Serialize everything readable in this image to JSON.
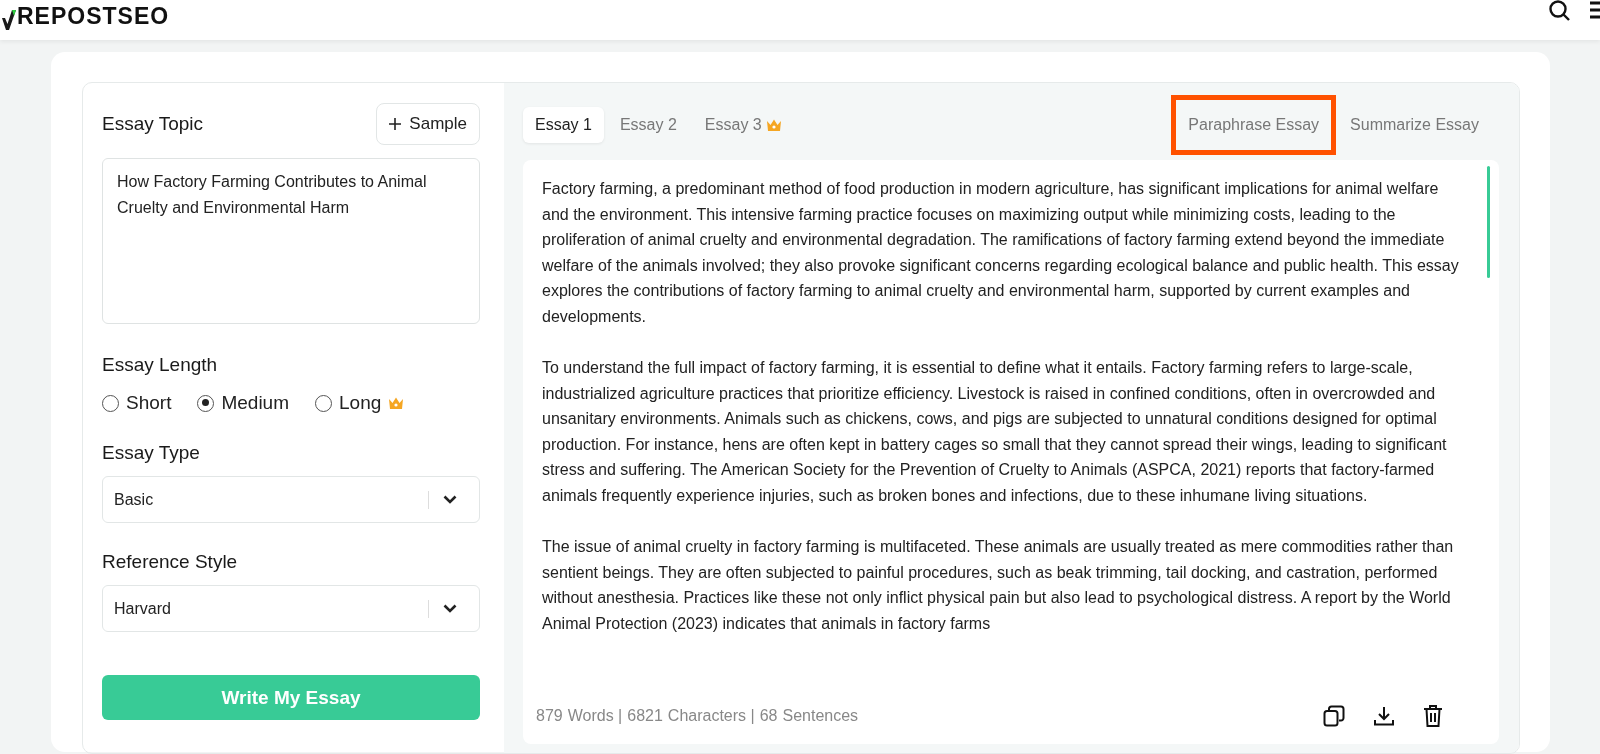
{
  "header": {
    "logo": "REPOSTSEO"
  },
  "form": {
    "topic_label": "Essay Topic",
    "sample_button": "Sample",
    "topic_value": "How Factory Farming Contributes to Animal Cruelty and Environmental Harm",
    "length_label": "Essay Length",
    "lengths": [
      {
        "label": "Short",
        "selected": false,
        "premium": false
      },
      {
        "label": "Medium",
        "selected": true,
        "premium": false
      },
      {
        "label": "Long",
        "selected": false,
        "premium": true
      }
    ],
    "type_label": "Essay Type",
    "type_value": "Basic",
    "reference_label": "Reference Style",
    "reference_value": "Harvard",
    "submit": "Write My Essay"
  },
  "tabs": [
    {
      "label": "Essay 1",
      "selected": true,
      "premium": false
    },
    {
      "label": "Essay 2",
      "selected": false,
      "premium": false
    },
    {
      "label": "Essay 3",
      "selected": false,
      "premium": true
    }
  ],
  "actions": [
    {
      "label": "Paraphrase Essay",
      "highlighted": true
    },
    {
      "label": "Summarize Essay",
      "highlighted": false
    }
  ],
  "essay": [
    "Factory farming, a predominant method of food production in modern agriculture, has significant implications for animal welfare and the environment. This intensive farming practice focuses on maximizing output while minimizing costs, leading to the proliferation of animal cruelty and environmental degradation. The ramifications of factory farming extend beyond the immediate welfare of the animals involved; they also provoke significant concerns regarding ecological balance and public health. This essay explores the contributions of factory farming to animal cruelty and environmental harm, supported by current examples and developments.",
    "To understand the full impact of factory farming, it is essential to define what it entails. Factory farming refers to large-scale, industrialized agriculture practices that prioritize efficiency. Livestock is raised in confined conditions, often in overcrowded and unsanitary environments. Animals such as chickens, cows, and pigs are subjected to unnatural conditions designed for optimal production. For instance, hens are often kept in battery cages so small that they cannot spread their wings, leading to significant stress and suffering. The American Society for the Prevention of Cruelty to Animals (ASPCA, 2021) reports that factory-farmed animals frequently experience injuries, such as broken bones and infections, due to these inhumane living situations.",
    "The issue of animal cruelty in factory farming is multifaceted. These animals are usually treated as mere commodities rather than sentient beings. They are often subjected to painful procedures, such as beak trimming, tail docking, and castration, performed without anesthesia. Practices like these not only inflict physical pain but also lead to psychological distress. A report by the World Animal Protection (2023) indicates that animals in factory farms"
  ],
  "stats": [
    {
      "value": "879",
      "unit": "Words |"
    },
    {
      "value": "6821",
      "unit": "Characters |"
    },
    {
      "value": "68",
      "unit": "Sentences"
    }
  ]
}
